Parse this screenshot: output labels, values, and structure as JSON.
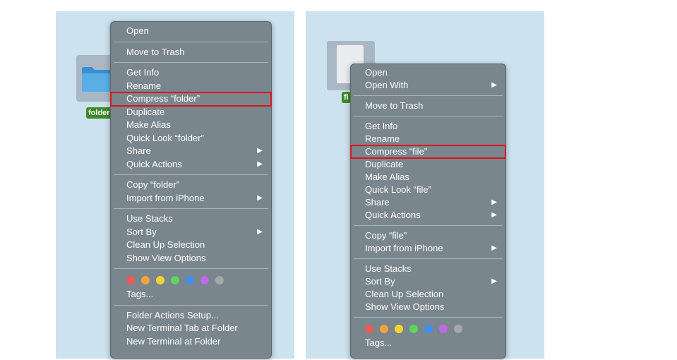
{
  "left": {
    "folder_label": "folder",
    "menu": {
      "group1": [
        "Open"
      ],
      "group2": [
        "Move to Trash"
      ],
      "group3": [
        {
          "label": "Get Info"
        },
        {
          "label": "Rename"
        },
        {
          "label": "Compress “folder”",
          "highlighted": true
        },
        {
          "label": "Duplicate"
        },
        {
          "label": "Make Alias"
        },
        {
          "label": "Quick Look “folder”"
        },
        {
          "label": "Share",
          "submenu": true
        },
        {
          "label": "Quick Actions",
          "submenu": true
        }
      ],
      "group4": [
        {
          "label": "Copy “folder”"
        },
        {
          "label": "Import from iPhone",
          "submenu": true
        }
      ],
      "group5": [
        {
          "label": "Use Stacks"
        },
        {
          "label": "Sort By",
          "submenu": true
        },
        {
          "label": "Clean Up Selection"
        },
        {
          "label": "Show View Options"
        }
      ],
      "tags_label": "Tags...",
      "group7": [
        "Folder Actions Setup...",
        "New Terminal Tab at Folder",
        "New Terminal at Folder"
      ]
    }
  },
  "right": {
    "file_label": "fi",
    "menu": {
      "group1": [
        {
          "label": "Open"
        },
        {
          "label": "Open With",
          "submenu": true
        }
      ],
      "group2": [
        "Move to Trash"
      ],
      "group3": [
        {
          "label": "Get Info"
        },
        {
          "label": "Rename"
        },
        {
          "label": "Compress “file”",
          "highlighted": true
        },
        {
          "label": "Duplicate"
        },
        {
          "label": "Make Alias"
        },
        {
          "label": "Quick Look “file”"
        },
        {
          "label": "Share",
          "submenu": true
        },
        {
          "label": "Quick Actions",
          "submenu": true
        }
      ],
      "group4": [
        {
          "label": "Copy “file”"
        },
        {
          "label": "Import from iPhone",
          "submenu": true
        }
      ],
      "group5": [
        {
          "label": "Use Stacks"
        },
        {
          "label": "Sort By",
          "submenu": true
        },
        {
          "label": "Clean Up Selection"
        },
        {
          "label": "Show View Options"
        }
      ],
      "tags_label": "Tags..."
    }
  },
  "submenu_arrow": "▶",
  "tag_colors": [
    "#ee5a55",
    "#f2a33a",
    "#f5d432",
    "#5fd35d",
    "#3f8ff0",
    "#bd6ae4",
    "#a3a8ab"
  ],
  "highlight_color": "#d9151e"
}
